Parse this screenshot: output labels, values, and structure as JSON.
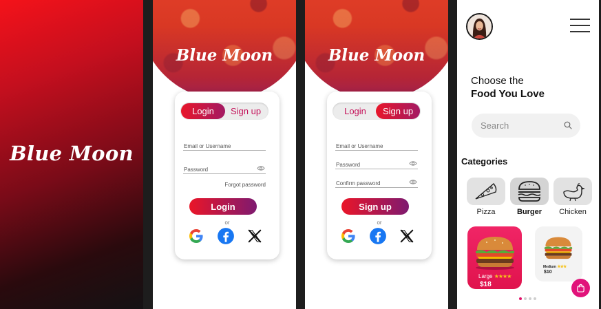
{
  "splash": {
    "brand": "Blue Moon"
  },
  "login_screen": {
    "hero_title": "Blue Moon",
    "tabs": {
      "login": "Login",
      "signup": "Sign up",
      "active": "login"
    },
    "fields": {
      "email": "Email or Username",
      "password": "Password"
    },
    "forgot": "Forgot password",
    "submit": "Login",
    "or": "or"
  },
  "signup_screen": {
    "hero_title": "Blue Moon",
    "tabs": {
      "login": "Login",
      "signup": "Sign up",
      "active": "signup"
    },
    "fields": {
      "email": "Email or Username",
      "password": "Password",
      "confirm": "Confirm password"
    },
    "submit": "Sign up",
    "or": "or"
  },
  "socials": [
    "google-icon",
    "facebook-icon",
    "x-icon"
  ],
  "home": {
    "greeting_line1": "Choose the",
    "greeting_line2": "Food You Love",
    "search_placeholder": "Search",
    "categories_title": "Categories",
    "categories": [
      {
        "label": "Pizza",
        "icon": "pizza-icon",
        "selected": false
      },
      {
        "label": "Burger",
        "icon": "burger-icon",
        "selected": true
      },
      {
        "label": "Chicken",
        "icon": "chicken-icon",
        "selected": false
      }
    ],
    "products": [
      {
        "size": "Large",
        "stars": "★★★★",
        "price": "$18"
      },
      {
        "size": "Medium",
        "stars": "★★★",
        "price": "$10"
      }
    ],
    "carousel": {
      "count": 4,
      "active": 0
    }
  },
  "colors": {
    "brand_red": "#ea1528",
    "brand_purple": "#7e1a70",
    "accent_pink": "#e1137a"
  }
}
